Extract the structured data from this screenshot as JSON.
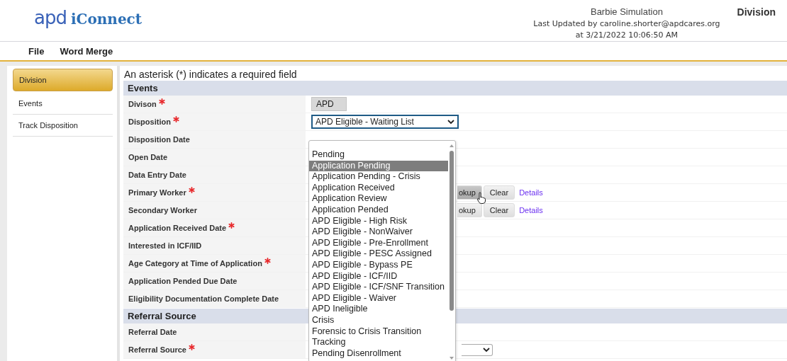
{
  "header": {
    "logo": {
      "mark": "apd",
      "name": "iConnect"
    },
    "record": "Barbie Simulation",
    "updated_by": "Last Updated by caroline.shorter@apdcares.org",
    "updated_at": "at 3/21/2022 10:06:50 AM",
    "page": "Division"
  },
  "menu": [
    {
      "label": "File"
    },
    {
      "label": "Word Merge"
    }
  ],
  "sidebar": [
    {
      "label": "Division",
      "selected": true
    },
    {
      "label": "Events",
      "selected": false
    },
    {
      "label": "Track Disposition",
      "selected": false
    }
  ],
  "note": "An asterisk (*) indicates a required field",
  "sections": [
    {
      "title": "Events",
      "fields": [
        {
          "label": "Divison",
          "required": true,
          "kind": "readonly",
          "value": "APD"
        },
        {
          "label": "Disposition",
          "required": true,
          "kind": "select",
          "value": "APD Eligible - Waiting List"
        },
        {
          "label": "Disposition Date",
          "required": false
        },
        {
          "label": "Open Date",
          "required": false
        },
        {
          "label": "Data Entry Date",
          "required": false
        },
        {
          "label": "Primary Worker",
          "required": true,
          "kind": "lookup",
          "buttons": [
            {
              "label": "okup",
              "hovered": true
            },
            {
              "label": "Clear",
              "hovered": false
            }
          ],
          "link": "Details"
        },
        {
          "label": "Secondary Worker",
          "required": false,
          "kind": "lookup",
          "buttons": [
            {
              "label": "okup",
              "hovered": false
            },
            {
              "label": "Clear",
              "hovered": false
            }
          ],
          "link": "Details"
        },
        {
          "label": "Application Received Date",
          "required": true
        },
        {
          "label": "Interested in ICF/IID",
          "required": false
        },
        {
          "label": "Age Category at Time of Application",
          "required": true
        },
        {
          "label": "Application Pended Due Date",
          "required": false
        },
        {
          "label": "Eligibility Documentation Complete Date",
          "required": false
        }
      ]
    },
    {
      "title": "Referral Source",
      "fields": [
        {
          "label": "Referral Date",
          "required": false
        },
        {
          "label": "Referral Source",
          "required": true,
          "kind": "select-stub"
        }
      ]
    }
  ],
  "dropdown": {
    "options": [
      {
        "label": "Pending",
        "selected": false
      },
      {
        "label": "Application Pending",
        "selected": true
      },
      {
        "label": "Application Pending - Crisis",
        "selected": false
      },
      {
        "label": "Application Received",
        "selected": false
      },
      {
        "label": "Application Review",
        "selected": false
      },
      {
        "label": "Application Pended",
        "selected": false
      },
      {
        "label": "APD Eligible - High Risk",
        "selected": false
      },
      {
        "label": "APD Eligible - NonWaiver",
        "selected": false
      },
      {
        "label": "APD Eligible - Pre-Enrollment",
        "selected": false
      },
      {
        "label": "APD Eligible - PESC Assigned",
        "selected": false
      },
      {
        "label": "APD Eligible - Bypass PE",
        "selected": false
      },
      {
        "label": "APD Eligible - ICF/IID",
        "selected": false
      },
      {
        "label": "APD Eligible - ICF/SNF Transition",
        "selected": false
      },
      {
        "label": "APD Eligible - Waiver",
        "selected": false
      },
      {
        "label": "APD Ineligible",
        "selected": false
      },
      {
        "label": "Crisis",
        "selected": false
      },
      {
        "label": "Forensic to Crisis Transition",
        "selected": false
      },
      {
        "label": "Tracking",
        "selected": false
      },
      {
        "label": "Pending Disenrollment",
        "selected": false
      }
    ]
  }
}
